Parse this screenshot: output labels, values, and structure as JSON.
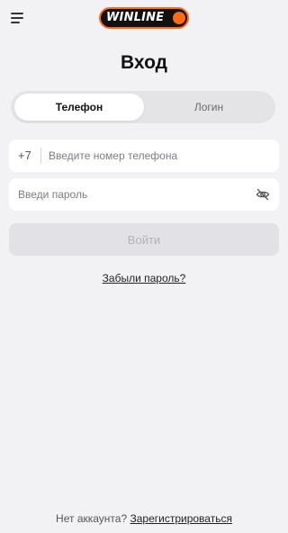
{
  "header": {
    "logo_text": "WINLINE",
    "brand_color": "#ff6a13"
  },
  "title": "Вход",
  "tabs": [
    {
      "label": "Телефон",
      "active": true
    },
    {
      "label": "Логин",
      "active": false
    }
  ],
  "phone": {
    "prefix": "+7",
    "value": "",
    "placeholder": "Введите номер телефона"
  },
  "password": {
    "value": "",
    "placeholder": "Введи пароль",
    "icon": "eye-off-icon"
  },
  "submit_label": "Войти",
  "forgot_label": "Забыли пароль?",
  "footer": {
    "question": "Нет аккаунта?",
    "register_label": "Зарегистрироваться"
  }
}
